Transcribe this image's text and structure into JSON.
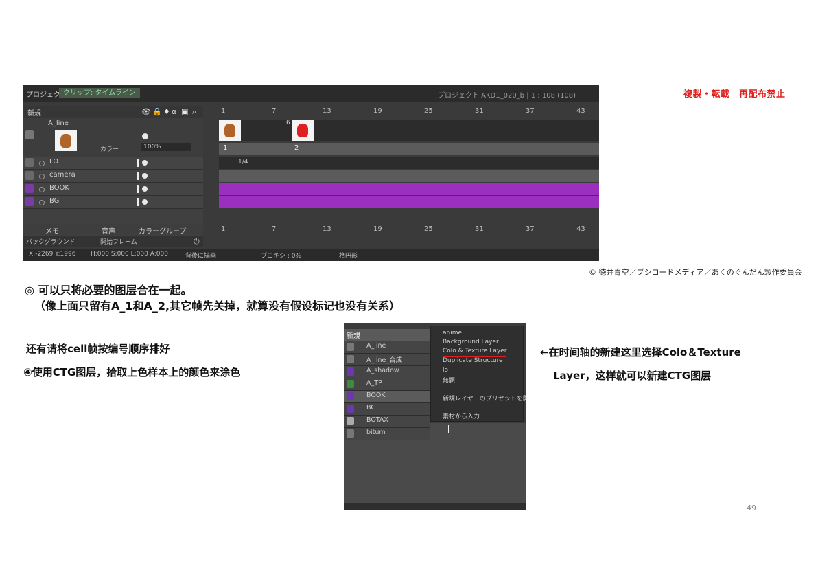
{
  "copy_notice": "複製・転載　再配布禁止",
  "copyright": "© 徳井青空／ブシロードメディア／あくのぐんだん製作委員会",
  "timeline": {
    "tab_project": "プロジェクト",
    "tab_clip": "クリップ: タイムライン",
    "project_info": "プロジェクト AKD1_020_b | 1 : 108 (108)",
    "new_label": "新規",
    "layers": [
      {
        "name": "A_line"
      },
      {
        "name": "LO"
      },
      {
        "name": "camera"
      },
      {
        "name": "BOOK"
      },
      {
        "name": "BG"
      }
    ],
    "color_label": "カラー",
    "opacity": "100%",
    "ruler": [
      "1",
      "7",
      "13",
      "19",
      "25",
      "31",
      "37",
      "43"
    ],
    "cell_numbers": [
      "6",
      "1",
      "2",
      "1/4"
    ],
    "buttons": [
      "メモ",
      "音声",
      "カラーグループ"
    ],
    "background_label": "バックグラウンド",
    "start_frame_label": "開始フレーム",
    "status": {
      "coords": "X:-2269 Y:1996",
      "hsl": "H:000 S:000 L:000 A:000",
      "draw_back": "背後に描画",
      "proxy": "プロキシ : 0%",
      "ellipse": "楕円形"
    }
  },
  "text": {
    "line1": "◎ 可以只将必要的图层合在一起。",
    "line2": "（像上面只留有A_1和A_2,其它帧先关掉，就算没有假设标记也没有关系）",
    "line3": "还有请将cell帧按编号顺序排好",
    "line4": "④使用CTG图层，拾取上色样本上的颜色来涂色",
    "line5": "←在时间轴的新建这里选择Colo＆Texture",
    "line6": "Layer，这样就可以新建CTG图层"
  },
  "menu": {
    "new_label": "新規",
    "layers": [
      "A_line",
      "A_line_合成",
      "A_shadow",
      "A_TP",
      "BOOK",
      "BG",
      "BOTAX",
      "bitum"
    ],
    "items": [
      "anime",
      "Background Layer",
      "Colo & Texture Layer",
      "Duplicate Structure",
      "lo",
      "無題",
      "新規レイヤーのプリセットを開く",
      "素材から入力"
    ]
  },
  "page_number": "49"
}
